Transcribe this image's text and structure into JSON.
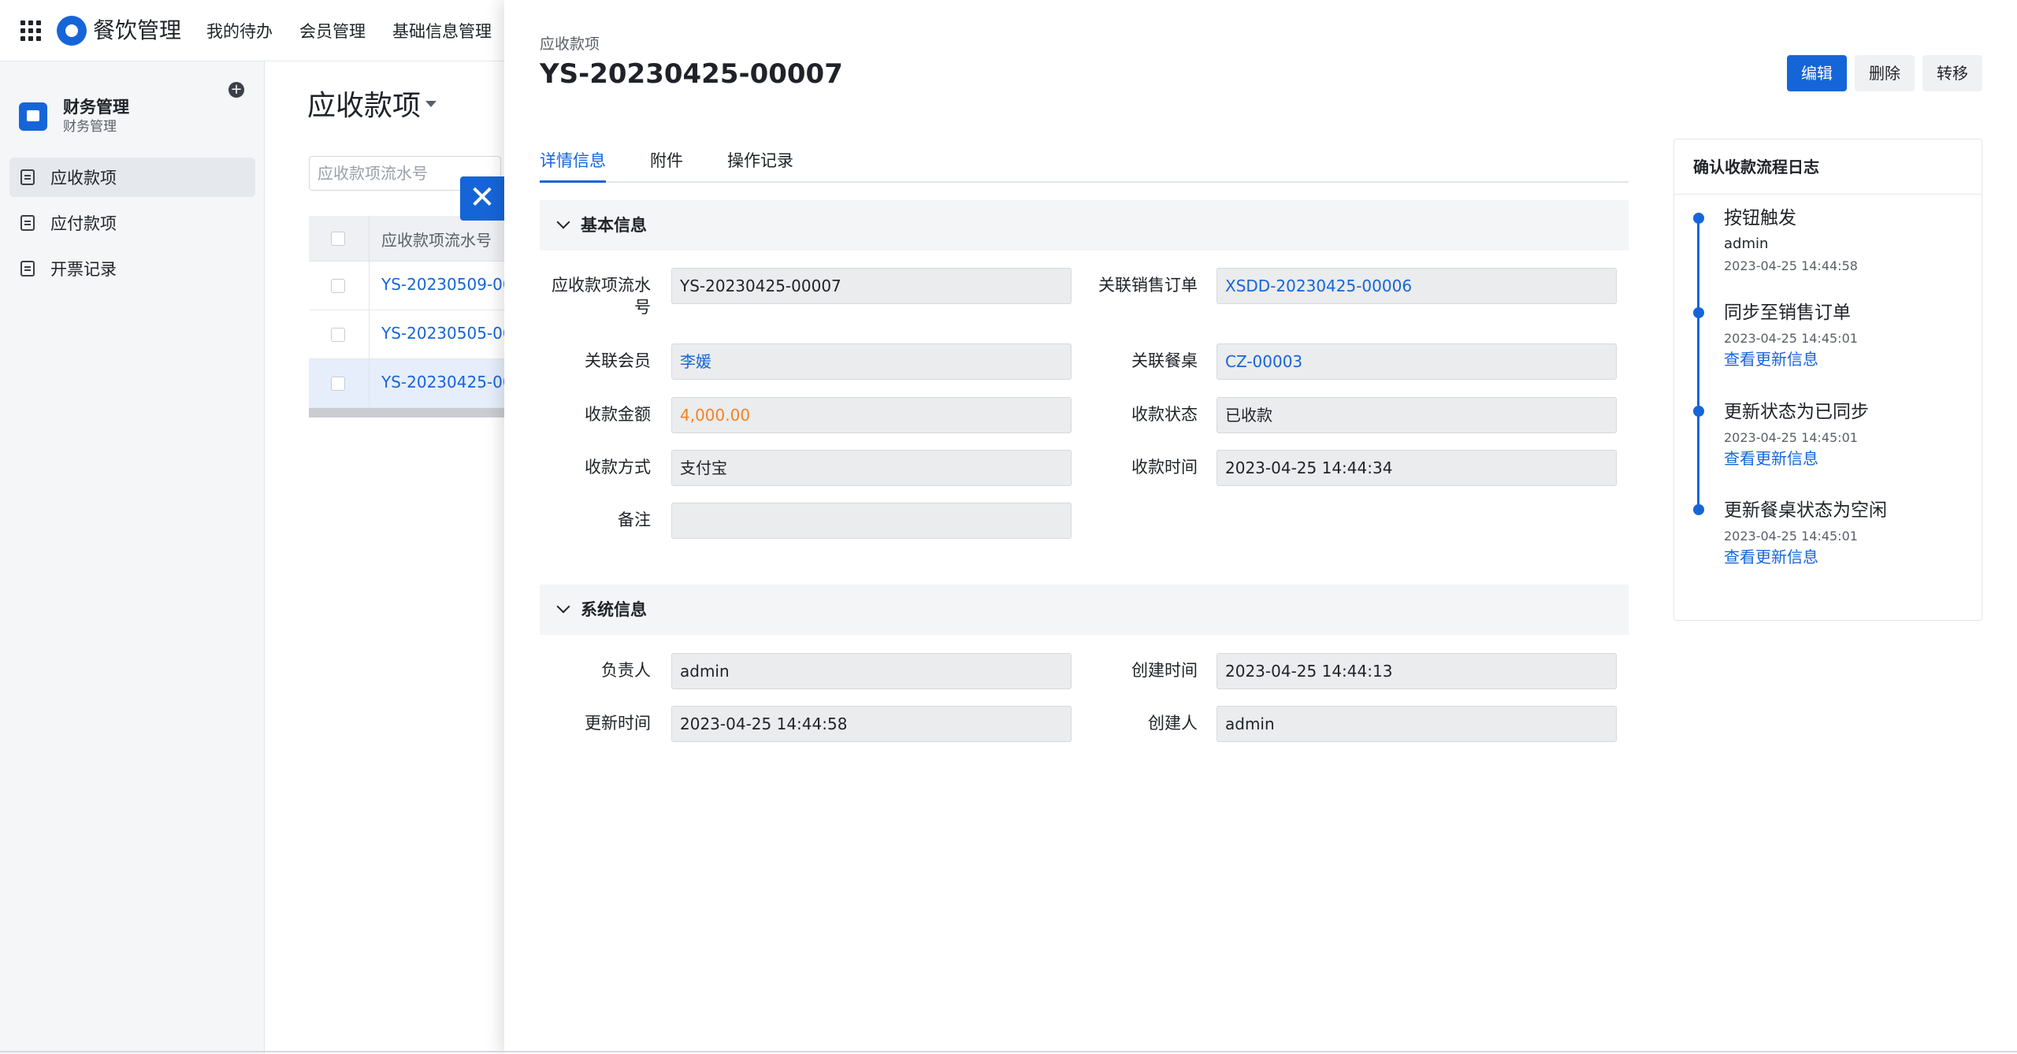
{
  "app": {
    "title": "餐饮管理"
  },
  "topnav": [
    "我的待办",
    "会员管理",
    "基础信息管理"
  ],
  "sidebar": {
    "module_title": "财务管理",
    "module_subtitle": "财务管理",
    "items": [
      {
        "label": "应收款项",
        "active": true
      },
      {
        "label": "应付款项",
        "active": false
      },
      {
        "label": "开票记录",
        "active": false
      }
    ]
  },
  "list": {
    "title": "应收款项",
    "search_placeholder": "应收款项流水号",
    "column": "应收款项流水号",
    "rows": [
      "YS-20230509-00...",
      "YS-20230505-00...",
      "YS-20230425-00..."
    ]
  },
  "drawer": {
    "breadcrumb": "应收款项",
    "title": "YS-20230425-00007",
    "buttons": {
      "edit": "编辑",
      "delete": "删除",
      "transfer": "转移"
    },
    "tabs": [
      "详情信息",
      "附件",
      "操作记录"
    ],
    "basic_section": "基本信息",
    "basic": {
      "serial_label": "应收款项流水号",
      "serial_value": "YS-20230425-00007",
      "sales_order_label": "关联销售订单",
      "sales_order_value": "XSDD-20230425-00006",
      "member_label": "关联会员",
      "member_value": "李媛",
      "table_label": "关联餐桌",
      "table_value": "CZ-00003",
      "amount_label": "收款金额",
      "amount_value": "4,000.00",
      "status_label": "收款状态",
      "status_value": "已收款",
      "method_label": "收款方式",
      "method_value": "支付宝",
      "time_label": "收款时间",
      "time_value": "2023-04-25 14:44:34",
      "remark_label": "备注",
      "remark_value": ""
    },
    "system_section": "系统信息",
    "system": {
      "owner_label": "负责人",
      "owner_value": "admin",
      "created_label": "创建时间",
      "created_value": "2023-04-25 14:44:13",
      "updated_label": "更新时间",
      "updated_value": "2023-04-25 14:44:58",
      "creator_label": "创建人",
      "creator_value": "admin"
    }
  },
  "log": {
    "title": "确认收款流程日志",
    "entries": [
      {
        "title": "按钮触发",
        "user": "admin",
        "time": "2023-04-25 14:44:58"
      },
      {
        "title": "同步至销售订单",
        "time": "2023-04-25 14:45:01",
        "link": "查看更新信息"
      },
      {
        "title": "更新状态为已同步",
        "time": "2023-04-25 14:45:01",
        "link": "查看更新信息"
      },
      {
        "title": "更新餐桌状态为空闲",
        "time": "2023-04-25 14:45:01",
        "link": "查看更新信息"
      }
    ]
  },
  "colors": {
    "primary": "#1665d8",
    "amount": "#f5821f"
  }
}
